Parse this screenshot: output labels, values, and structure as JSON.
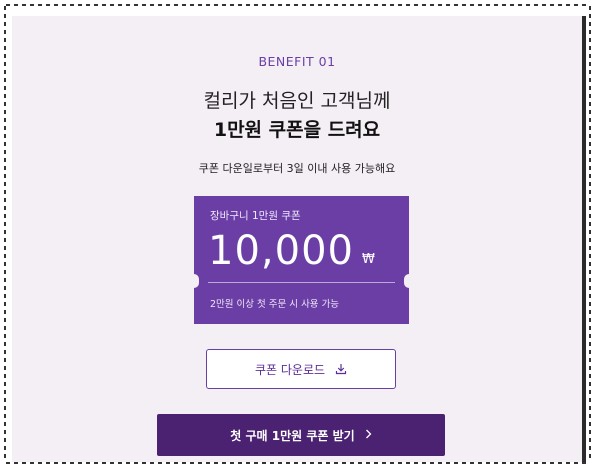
{
  "benefit": {
    "eyebrow": "BENEFIT 01",
    "title_line1": "컬리가 처음인 고객님께",
    "title_line2": "1만원 쿠폰을 드려요",
    "description": "쿠폰 다운일로부터 3일 이내 사용 가능해요"
  },
  "coupon": {
    "label": "장바구니 1만원 쿠폰",
    "amount": "10,000",
    "currency": "₩",
    "condition": "2만원 이상 첫 주문 시 사용 가능"
  },
  "download_button": {
    "label": "쿠폰 다운로드",
    "icon": "download-icon"
  },
  "cta_button": {
    "label": "첫 구매 1만원 쿠폰 받기",
    "icon": "chevron-right-icon"
  },
  "colors": {
    "accent": "#6a3ea4",
    "cta": "#4b2171",
    "background": "#f4eef5"
  }
}
